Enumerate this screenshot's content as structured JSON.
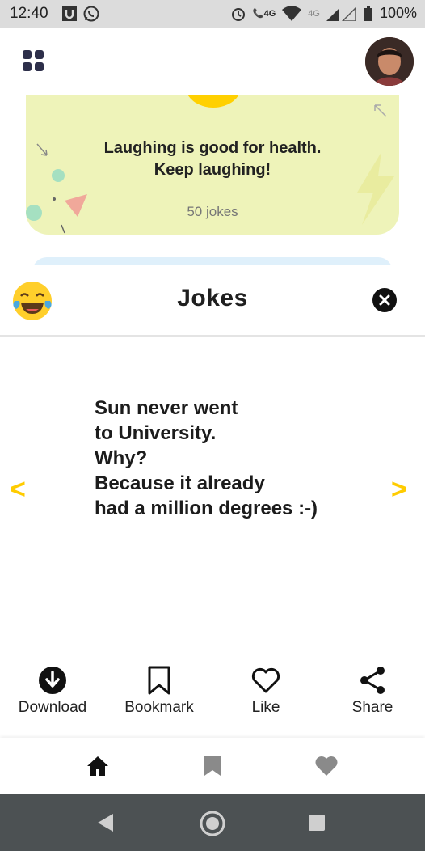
{
  "status_bar": {
    "time": "12:40",
    "battery": "100%",
    "network_1": "4G",
    "network_2": "4G"
  },
  "card": {
    "title_line1": "Laughing is good for health.",
    "title_line2": "Keep laughing!",
    "count": "50 jokes"
  },
  "sheet": {
    "title": "Jokes",
    "joke_text": "Sun never went\nto University.\nWhy?\nBecause it already\nhad a million degrees :-)",
    "prev": "<",
    "next": ">"
  },
  "actions": {
    "download": "Download",
    "bookmark": "Bookmark",
    "like": "Like",
    "share": "Share"
  },
  "colors": {
    "accent": "#ffcc00",
    "card_bg": "#eef3b9",
    "system_bar": "#4c5153"
  }
}
